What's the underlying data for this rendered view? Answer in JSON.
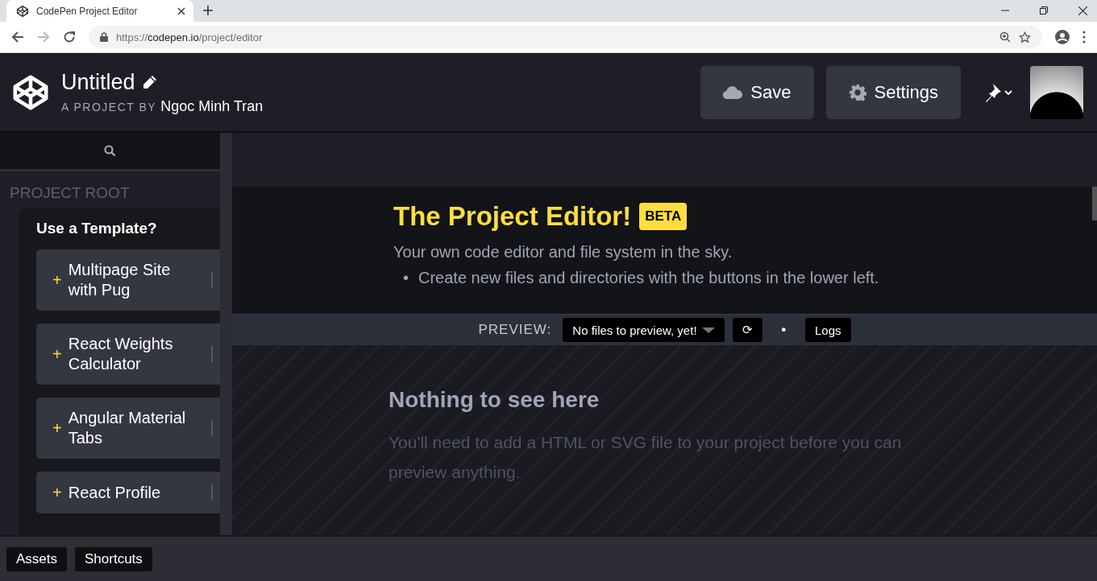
{
  "browser": {
    "tab_title": "CodePen Project Editor",
    "url_host": "codepen.io",
    "url_scheme": "https://",
    "url_path": "/project/editor"
  },
  "header": {
    "title": "Untitled",
    "byline_label": "A PROJECT BY",
    "author": "Ngoc Minh Tran",
    "buttons": [
      {
        "label": "Save",
        "kind": "cloud"
      },
      {
        "label": "Settings",
        "kind": "gear"
      }
    ]
  },
  "sidebar": {
    "section": "PROJECT ROOT",
    "templates_heading": "Use a Template?",
    "templates": [
      {
        "plus": "+",
        "name": "Multipage Site with Pug"
      },
      {
        "plus": "+",
        "name": "React Weights Calculator"
      },
      {
        "plus": "+",
        "name": "Angular Material Tabs"
      },
      {
        "plus": "+",
        "name": "React Profile"
      }
    ]
  },
  "document": {
    "heading": "The Project Editor!",
    "badge": "BETA",
    "intro": "Your own code editor and file system in the sky.",
    "bullets": [
      {
        "marker": "•",
        "text": "Create new files and directories with the buttons in the lower left."
      }
    ]
  },
  "preview": {
    "label": "PREVIEW:",
    "select": "No files to preview, yet!",
    "refresh": "⟳",
    "dot": "•",
    "logs": "Logs",
    "empty_title": "Nothing to see here",
    "empty_text": "You'll need to add a HTML or SVG file to your project before you can preview anything."
  },
  "footer": {
    "buttons": [
      "Assets",
      "Shortcuts"
    ]
  }
}
